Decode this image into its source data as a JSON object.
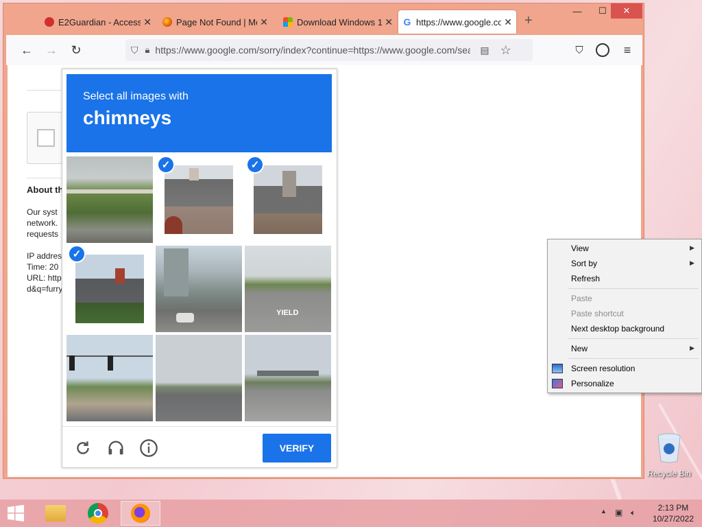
{
  "tabs": [
    {
      "label": "E2Guardian - Access D",
      "icon": "e2guardian-icon",
      "color": "#d32f2f"
    },
    {
      "label": "Page Not Found | Moz",
      "icon": "firefox-icon",
      "color": "#e66000"
    },
    {
      "label": "Download Windows 11",
      "icon": "microsoft-icon",
      "color": "#00a4ef"
    },
    {
      "label": "https://www.google.co",
      "icon": "google-icon",
      "color": "#4285f4",
      "active": true
    }
  ],
  "window_controls": {
    "minimize": "—",
    "maximize": "☐",
    "close": "✕"
  },
  "navbar": {
    "url": "https://www.google.com/sorry/index?continue=https://www.google.com/sea"
  },
  "page": {
    "heading": "About th",
    "lines": [
      "Our syst",
      "network.",
      "requests"
    ],
    "info": [
      "IP addres",
      "Time: 20",
      "URL: http",
      "d&q=furry"
    ]
  },
  "captcha": {
    "instruction": "Select all images with",
    "target": "chimneys",
    "verify_label": "VERIFY",
    "tiles": [
      {
        "selected": false,
        "scene": "highway-bridge"
      },
      {
        "selected": true,
        "scene": "house-chimney"
      },
      {
        "selected": true,
        "scene": "house-chimney"
      },
      {
        "selected": true,
        "scene": "house-chimney"
      },
      {
        "selected": false,
        "scene": "city-street"
      },
      {
        "selected": false,
        "scene": "road-yield"
      },
      {
        "selected": false,
        "scene": "traffic-lights"
      },
      {
        "selected": false,
        "scene": "highway"
      },
      {
        "selected": false,
        "scene": "highway-signs"
      }
    ]
  },
  "context_menu": {
    "view": "View",
    "sort_by": "Sort by",
    "refresh": "Refresh",
    "paste": "Paste",
    "paste_shortcut": "Paste shortcut",
    "next_background": "Next desktop background",
    "new": "New",
    "screen_resolution": "Screen resolution",
    "personalize": "Personalize"
  },
  "desktop": {
    "recycle_bin": "Recycle Bin"
  },
  "taskbar": {
    "time": "2:13 PM",
    "date": "10/27/2022"
  },
  "colors": {
    "accent": "#1a73e8",
    "window_frame": "#f0a58c"
  }
}
